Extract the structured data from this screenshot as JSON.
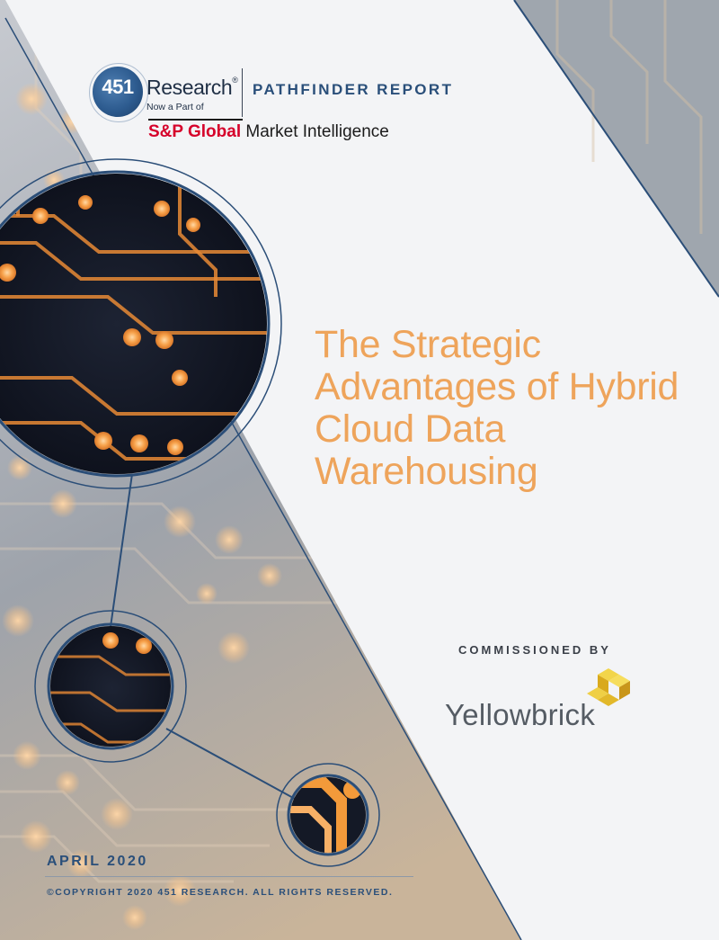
{
  "logo": {
    "number": "451",
    "research": "Research",
    "registered": "®",
    "now_part_of": "Now a Part of",
    "report_type": "PATHFINDER REPORT",
    "sp_brand": "S&P Global",
    "sp_division": " Market Intelligence"
  },
  "document": {
    "title": "The Strategic Advantages of Hybrid Cloud Data Warehousing",
    "commissioned_by": "COMMISSIONED BY",
    "sponsor": "Yellowbrick",
    "date": "APRIL 2020",
    "copyright": "©COPYRIGHT 2020 451 RESEARCH. ALL RIGHTS RESERVED."
  },
  "colors": {
    "title": "#eea45b",
    "navy": "#2a4f7a",
    "circuit_trace": "#f39a3a",
    "sp_red": "#d6002a",
    "yellowbrick_gold": "#e8c12a"
  }
}
